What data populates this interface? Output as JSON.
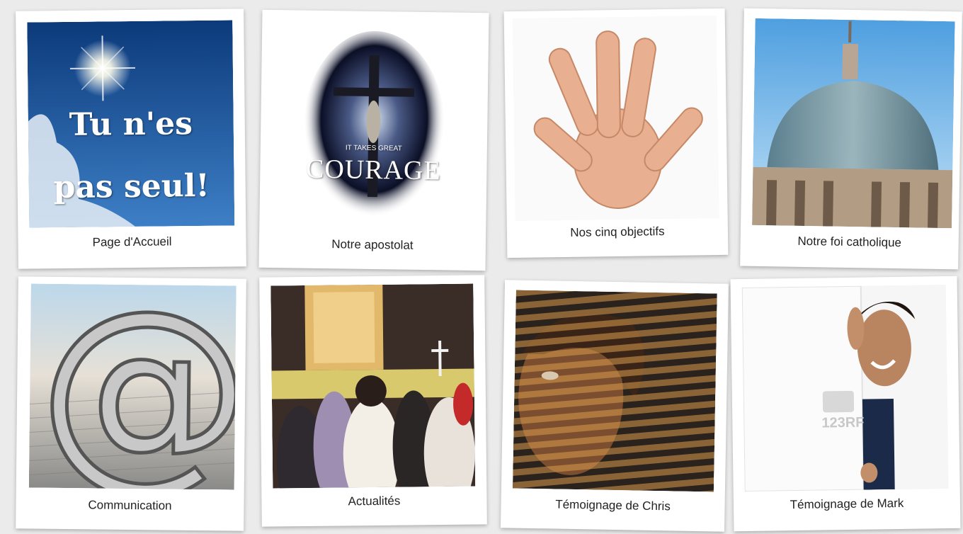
{
  "tiles": [
    {
      "caption": "Page d'Accueil",
      "image_text_line1": "Tu n'es",
      "image_text_line2": "pas seul!"
    },
    {
      "caption": "Notre apostolat",
      "image_text_small": "IT TAKES GREAT",
      "image_text_big": "COURAGE"
    },
    {
      "caption": "Nos cinq objectifs"
    },
    {
      "caption": "Notre foi catholique"
    },
    {
      "caption": "Communication"
    },
    {
      "caption": "Actualités"
    },
    {
      "caption": "Témoignage de Chris"
    },
    {
      "caption": "Témoignage de Mark",
      "watermark": "123RF"
    }
  ],
  "colors": {
    "background": "#ebebeb",
    "card": "#ffffff",
    "caption_text": "#222222"
  }
}
